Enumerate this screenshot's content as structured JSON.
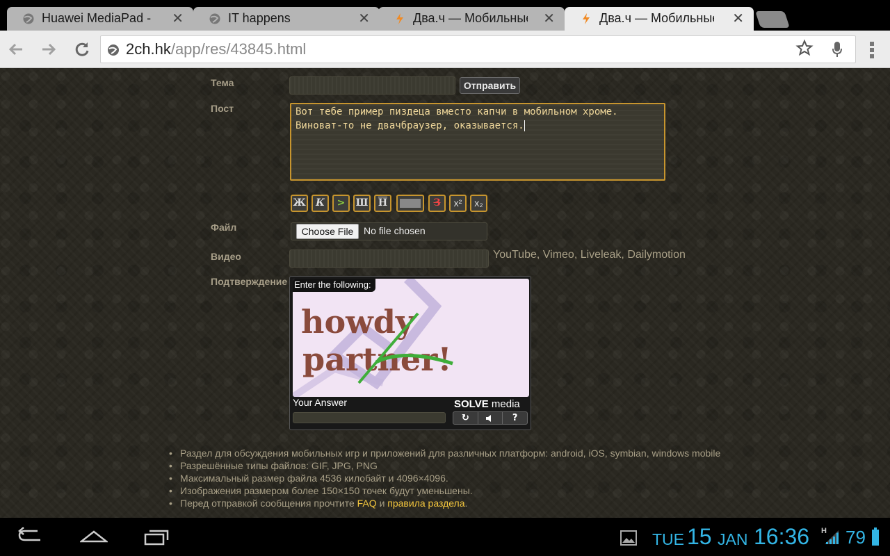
{
  "browser": {
    "tabs": [
      {
        "title": "Huawei MediaPad -",
        "favicon": "globe-icon",
        "close": "✕"
      },
      {
        "title": "IT happens",
        "favicon": "globe-icon",
        "close": "✕"
      },
      {
        "title": "Два.ч — Мобильные",
        "favicon": "lightning-icon",
        "close": "✕"
      },
      {
        "title": "Два.ч — Мобильные",
        "favicon": "lightning-icon",
        "close": "✕",
        "active": true
      }
    ],
    "url_domain": "2ch.hk",
    "url_path": "/app/res/43845.html"
  },
  "form": {
    "subject_label": "Тема",
    "submit_label": "Отправить",
    "post_label": "Пост",
    "post_text": [
      "Вот тебе пример пиздеца вместо капчи в мобильном хроме.",
      "Виноват-то не двачбраузер, оказывается."
    ],
    "format_buttons": [
      "Ж",
      "К",
      ">",
      "Ш",
      "Н",
      "spoiler",
      "З",
      "x²",
      "x₂"
    ],
    "file_label": "Файл",
    "choose_file": "Choose File",
    "no_file": "No file chosen",
    "video_label": "Видео",
    "video_hint": "YouTube, Vimeo, Liveleak, Dailymotion",
    "confirm_label": "Подтверждение"
  },
  "captcha": {
    "enter_following": "Enter the following:",
    "image_text_line1": "howdy",
    "image_text_line2": "partner!",
    "your_answer": "Your Answer",
    "brand_solve": "SOLVE",
    "brand_media": "media",
    "buttons": [
      "↻",
      "🔈",
      "?"
    ]
  },
  "rules": {
    "items": [
      "Раздел для обсуждения мобильных игр и приложений для различных платформ: android, iOS, symbian, windows mobile",
      "Разрешённые типы файлов: GIF, JPG, PNG",
      "Максимальный размер файла 4536 килобайт и 4096×4096.",
      "Изображения размером более 150×150 точек будут уменьшены."
    ],
    "last_prefix": "Перед отправкой сообщения прочтите",
    "faq_link": "FAQ",
    "and": "и",
    "rules_link": "правила раздела",
    "period": "."
  },
  "system": {
    "day": "TUE",
    "date": "15",
    "month": "JAN",
    "time": "16:36",
    "network": "H",
    "battery": "79"
  },
  "colors": {
    "accent": "#33b5e5",
    "highlight": "#c7952e",
    "link": "#f2c53d"
  }
}
